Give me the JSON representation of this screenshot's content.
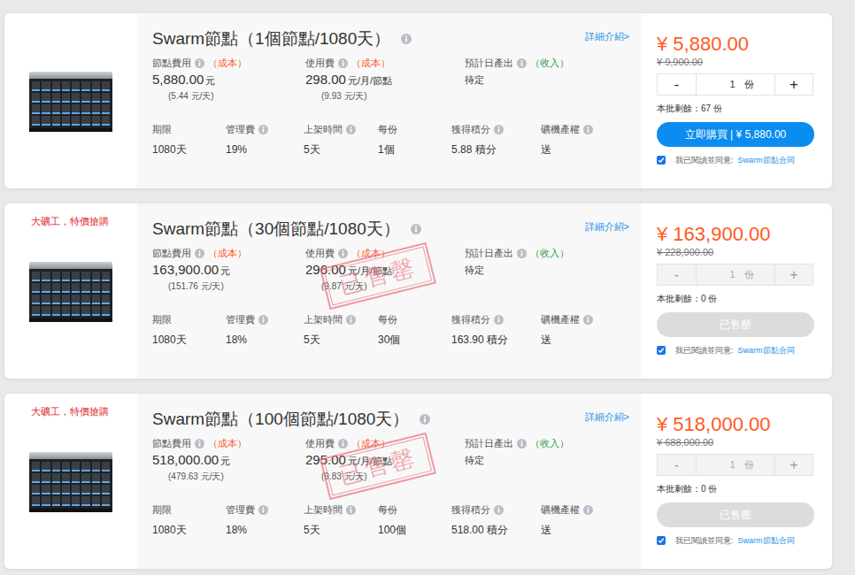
{
  "cards": [
    {
      "promo": "",
      "title": "Swarm節點（1個節點/1080天）",
      "detail_link": "詳細介紹>",
      "fees": [
        {
          "label": "節點費用",
          "tag": "（成本）",
          "tag_color": "#ff5a1f",
          "value": "5,880.00",
          "unit": "元",
          "daily": "(5.44 元/天)"
        },
        {
          "label": "使用費",
          "tag": "（成本）",
          "tag_color": "#ff5a1f",
          "value": "298.00",
          "unit": "元/月/節點",
          "daily": "(9.93 元/天)"
        },
        {
          "label": "預計日產出",
          "tag": "（收入）",
          "tag_color": "#2e9e4f",
          "value": "待定",
          "unit": "",
          "daily": ""
        }
      ],
      "specs": [
        {
          "label": "期限",
          "value": "1080天",
          "info": false
        },
        {
          "label": "管理費",
          "value": "19%",
          "info": true
        },
        {
          "label": "上架時間",
          "value": "5天",
          "info": true
        },
        {
          "label": "每份",
          "value": "1個",
          "info": false
        },
        {
          "label": "獲得積分",
          "value": "5.88 積分",
          "info": true
        },
        {
          "label": "礦機產權",
          "value": "送",
          "info": true
        }
      ],
      "stamp": "",
      "price": "¥ 5,880.00",
      "original_price": "¥ 9,900.00",
      "quantity": {
        "minus": "-",
        "value": "1",
        "unit": "份",
        "plus": "+",
        "disabled": false
      },
      "remaining": "本批剩餘：67 份",
      "button": {
        "label": "立即購買 | ¥ 5,880.00",
        "disabled": false
      },
      "agreement": {
        "checked": true,
        "text": "我已閱讀並同意:",
        "link": "Swarm節點合同"
      }
    },
    {
      "promo": "大礦工，特價搶購",
      "title": "Swarm節點（30個節點/1080天）",
      "detail_link": "詳細介紹>",
      "fees": [
        {
          "label": "節點費用",
          "tag": "（成本）",
          "tag_color": "#ff5a1f",
          "value": "163,900.00",
          "unit": "元",
          "daily": "(151.76 元/天)"
        },
        {
          "label": "使用費",
          "tag": "（成本）",
          "tag_color": "#ff5a1f",
          "value": "296.00",
          "unit": "元/月/節點",
          "daily": "(9.87 元/天)"
        },
        {
          "label": "預計日產出",
          "tag": "（收入）",
          "tag_color": "#2e9e4f",
          "value": "待定",
          "unit": "",
          "daily": ""
        }
      ],
      "specs": [
        {
          "label": "期限",
          "value": "1080天",
          "info": false
        },
        {
          "label": "管理費",
          "value": "18%",
          "info": true
        },
        {
          "label": "上架時間",
          "value": "5天",
          "info": true
        },
        {
          "label": "每份",
          "value": "30個",
          "info": false
        },
        {
          "label": "獲得積分",
          "value": "163.90 積分",
          "info": true
        },
        {
          "label": "礦機產權",
          "value": "送",
          "info": true
        }
      ],
      "stamp": "已售罄",
      "price": "¥ 163,900.00",
      "original_price": "¥ 228,900.00",
      "quantity": {
        "minus": "-",
        "value": "1",
        "unit": "份",
        "plus": "+",
        "disabled": true
      },
      "remaining": "本批剩餘：0 份",
      "button": {
        "label": "已售罄",
        "disabled": true
      },
      "agreement": {
        "checked": true,
        "text": "我已閱讀並同意:",
        "link": "Swarm節點合同"
      }
    },
    {
      "promo": "大礦工，特價搶購",
      "title": "Swarm節點（100個節點/1080天）",
      "detail_link": "詳細介紹>",
      "fees": [
        {
          "label": "節點費用",
          "tag": "（成本）",
          "tag_color": "#ff5a1f",
          "value": "518,000.00",
          "unit": "元",
          "daily": "(479.63 元/天)"
        },
        {
          "label": "使用費",
          "tag": "（成本）",
          "tag_color": "#ff5a1f",
          "value": "295.00",
          "unit": "元/月/節點",
          "daily": "(9.83 元/天)"
        },
        {
          "label": "預計日產出",
          "tag": "（收入）",
          "tag_color": "#2e9e4f",
          "value": "待定",
          "unit": "",
          "daily": ""
        }
      ],
      "specs": [
        {
          "label": "期限",
          "value": "1080天",
          "info": false
        },
        {
          "label": "管理費",
          "value": "18%",
          "info": true
        },
        {
          "label": "上架時間",
          "value": "5天",
          "info": true
        },
        {
          "label": "每份",
          "value": "100個",
          "info": false
        },
        {
          "label": "獲得積分",
          "value": "518.00 積分",
          "info": true
        },
        {
          "label": "礦機產權",
          "value": "送",
          "info": true
        }
      ],
      "stamp": "已售罄",
      "price": "¥ 518,000.00",
      "original_price": "¥ 688,000.00",
      "quantity": {
        "minus": "-",
        "value": "1",
        "unit": "份",
        "plus": "+",
        "disabled": true
      },
      "remaining": "本批剩餘：0 份",
      "button": {
        "label": "已售罄",
        "disabled": true
      },
      "agreement": {
        "checked": true,
        "text": "我已閱讀並同意:",
        "link": "Swarm節點合同"
      }
    }
  ]
}
